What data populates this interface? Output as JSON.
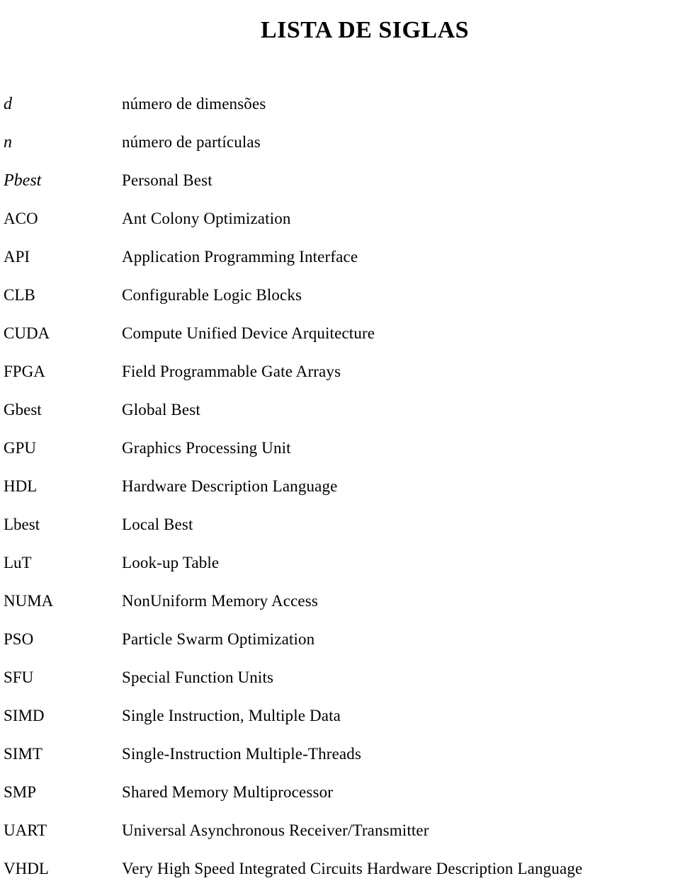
{
  "document": {
    "title": "LISTA DE SIGLAS",
    "background_color": "#ffffff",
    "text_color": "#000000"
  },
  "glossary": {
    "entries": [
      {
        "term": "d",
        "style": "math",
        "definition": "número de dimensões"
      },
      {
        "term": "n",
        "style": "math",
        "definition": "número de partículas"
      },
      {
        "term": "Pbest",
        "style": "math",
        "definition": "Personal Best"
      },
      {
        "term": "ACO",
        "style": "roman",
        "definition": "Ant Colony Optimization"
      },
      {
        "term": "API",
        "style": "roman",
        "definition": "Application Programming Interface"
      },
      {
        "term": "CLB",
        "style": "roman",
        "definition": "Configurable Logic Blocks"
      },
      {
        "term": "CUDA",
        "style": "roman",
        "definition": "Compute Unified Device Arquitecture"
      },
      {
        "term": "FPGA",
        "style": "roman",
        "definition": "Field Programmable Gate Arrays"
      },
      {
        "term": "Gbest",
        "style": "roman",
        "definition": "Global Best"
      },
      {
        "term": "GPU",
        "style": "roman",
        "definition": "Graphics Processing Unit"
      },
      {
        "term": "HDL",
        "style": "roman",
        "definition": "Hardware Description Language"
      },
      {
        "term": "Lbest",
        "style": "roman",
        "definition": "Local Best"
      },
      {
        "term": "LuT",
        "style": "roman",
        "definition": "Look-up Table"
      },
      {
        "term": "NUMA",
        "style": "roman",
        "definition": "NonUniform Memory Access"
      },
      {
        "term": "PSO",
        "style": "roman",
        "definition": "Particle Swarm Optimization"
      },
      {
        "term": "SFU",
        "style": "roman",
        "definition": "Special Function Units"
      },
      {
        "term": "SIMD",
        "style": "roman",
        "definition": "Single Instruction, Multiple Data"
      },
      {
        "term": "SIMT",
        "style": "roman",
        "definition": "Single-Instruction Multiple-Threads"
      },
      {
        "term": "SMP",
        "style": "roman",
        "definition": "Shared Memory Multiprocessor"
      },
      {
        "term": "UART",
        "style": "roman",
        "definition": "Universal Asynchronous Receiver/Transmitter"
      },
      {
        "term": "VHDL",
        "style": "roman",
        "definition": "Very High Speed Integrated Circuits Hardware Description Language"
      }
    ]
  }
}
